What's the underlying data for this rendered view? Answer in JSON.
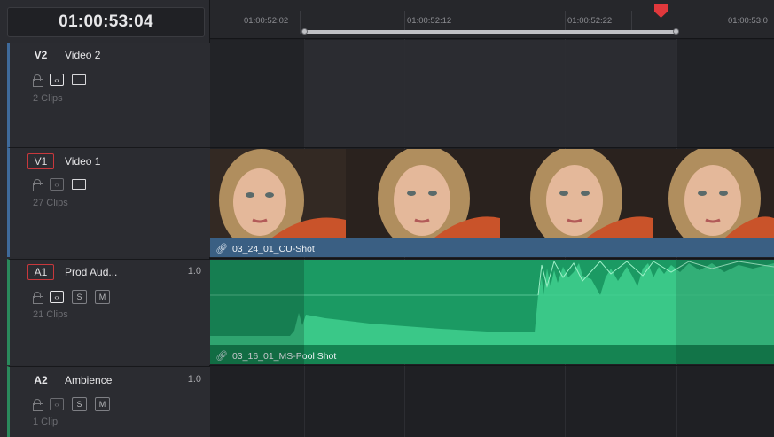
{
  "timecode": "01:00:53:04",
  "ruler": {
    "ticks": [
      "01:00:52:02",
      "01:00:52:12",
      "01:00:52:22",
      "01:00:53:0"
    ]
  },
  "tracks": [
    {
      "id": "V2",
      "name": "Video 2",
      "clips": "2 Clips",
      "level": ""
    },
    {
      "id": "V1",
      "name": "Video 1",
      "clips": "27 Clips",
      "level": ""
    },
    {
      "id": "A1",
      "name": "Prod Aud...",
      "clips": "21 Clips",
      "level": "1.0",
      "solo": "S",
      "mute": "M"
    },
    {
      "id": "A2",
      "name": "Ambience",
      "clips": "1 Clip",
      "level": "1.0",
      "solo": "S",
      "mute": "M"
    }
  ],
  "clips": {
    "video": "03_24_01_CU-Shot",
    "audio": "03_16_01_MS-Pool Shot"
  },
  "colors": {
    "playhead": "#d23a3d",
    "video_clip": "#3a5f83",
    "audio_clip": "#1b9a63",
    "track_select": "#c8383c"
  },
  "icons": [
    "lock-icon",
    "auto-select-icon",
    "monitor-icon",
    "link-icon",
    "playhead-marker-icon"
  ]
}
